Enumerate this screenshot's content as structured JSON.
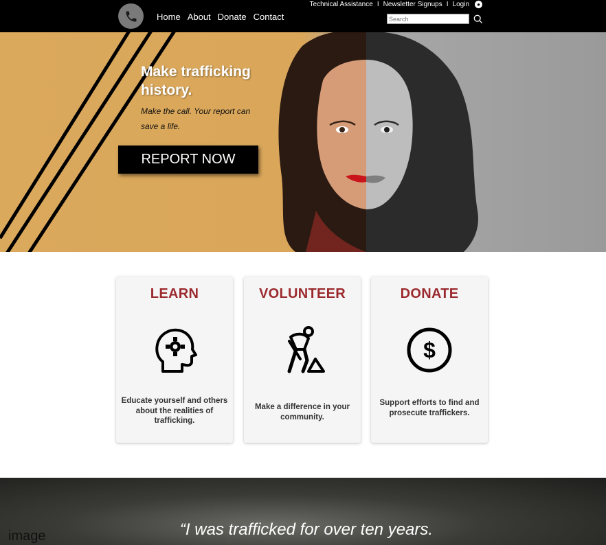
{
  "utility": {
    "links": [
      "Technical Assistance",
      "Newsletter Signups",
      "Login"
    ],
    "separator": "I"
  },
  "nav": {
    "items": [
      "Home",
      "About",
      "Donate",
      "Contact"
    ],
    "search_placeholder": "Search"
  },
  "hero": {
    "title": "Make trafficking history.",
    "subtitle": "Make the call. Your report can save a life.",
    "button_label": "REPORT NOW"
  },
  "cards": [
    {
      "title": "LEARN",
      "icon": "head-gear-icon",
      "description": "Educate yourself and others about the realities of trafficking."
    },
    {
      "title": "VOLUNTEER",
      "icon": "worker-icon",
      "description": "Make a difference in your community."
    },
    {
      "title": "DONATE",
      "icon": "dollar-coin-icon",
      "description": "Support efforts to find and prosecute traffickers."
    }
  ],
  "testimonial": {
    "quote": "“I was trafficked for over ten years.",
    "image_label": "image"
  },
  "colors": {
    "accent": "#9b2a2e",
    "hero_gold": "#dba95c",
    "nav_bg": "#000000"
  }
}
